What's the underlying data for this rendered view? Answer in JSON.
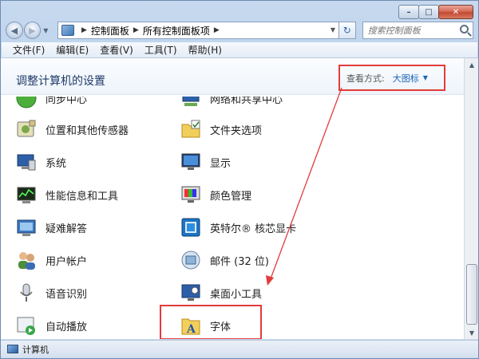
{
  "window": {
    "caption_buttons": [
      "minimize-icon",
      "maximize-icon",
      "close-icon"
    ]
  },
  "nav": {
    "back_icon": "back-arrow-icon",
    "forward_icon": "forward-arrow-icon",
    "breadcrumbs": [
      "控制面板",
      "所有控制面板项"
    ],
    "refresh_icon": "refresh-icon",
    "search_placeholder": "搜索控制面板"
  },
  "menubar": {
    "items": [
      "文件(F)",
      "编辑(E)",
      "查看(V)",
      "工具(T)",
      "帮助(H)"
    ]
  },
  "header": {
    "title": "调整计算机的设置",
    "view_by_label": "查看方式:",
    "view_by_value": "大图标"
  },
  "items": {
    "left": [
      {
        "label": "同步中心",
        "icon": "sync-center-icon"
      },
      {
        "label": "位置和其他传感器",
        "icon": "location-sensor-icon"
      },
      {
        "label": "系统",
        "icon": "system-icon"
      },
      {
        "label": "性能信息和工具",
        "icon": "performance-icon"
      },
      {
        "label": "疑难解答",
        "icon": "troubleshooting-icon"
      },
      {
        "label": "用户帐户",
        "icon": "user-accounts-icon"
      },
      {
        "label": "语音识别",
        "icon": "microphone-icon"
      },
      {
        "label": "自动播放",
        "icon": "autoplay-icon"
      }
    ],
    "right": [
      {
        "label": "网络和共享中心",
        "icon": "network-icon"
      },
      {
        "label": "文件夹选项",
        "icon": "folder-options-icon"
      },
      {
        "label": "显示",
        "icon": "display-icon"
      },
      {
        "label": "颜色管理",
        "icon": "color-management-icon"
      },
      {
        "label": "英特尔® 核芯显卡",
        "icon": "intel-graphics-icon"
      },
      {
        "label": "邮件 (32 位)",
        "icon": "mail-icon"
      },
      {
        "label": "桌面小工具",
        "icon": "desktop-gadgets-icon"
      },
      {
        "label": "字体",
        "icon": "fonts-folder-icon"
      }
    ]
  },
  "status": {
    "label": "计算机"
  },
  "colors": {
    "annotation_red": "#e23b3b",
    "link_blue": "#1d63b7"
  }
}
